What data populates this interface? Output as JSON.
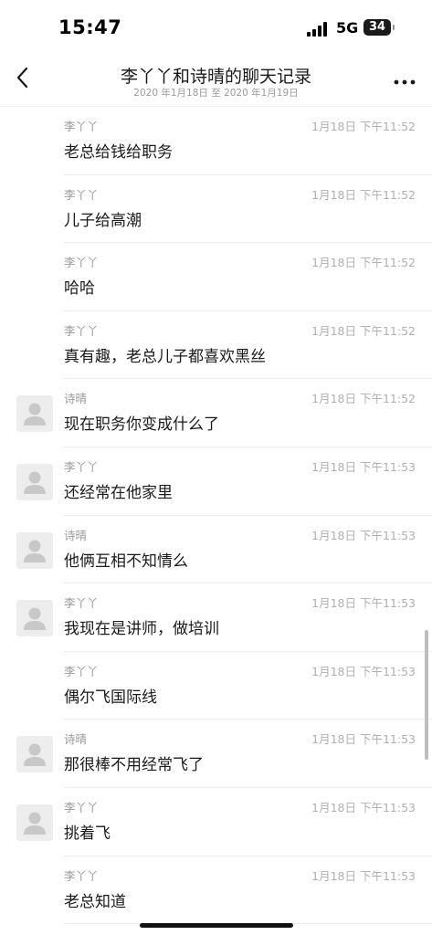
{
  "status_bar": {
    "time": "15:47",
    "network": "5G",
    "battery": "34"
  },
  "nav": {
    "back_icon": "chevron-left-icon",
    "title": "李丫丫和诗晴的聊天记录",
    "subtitle": "2020 年1月18日 至 2020 年1月19日",
    "more_icon": "ellipsis-icon"
  },
  "messages": [
    {
      "sender": "李丫丫",
      "time": "1月18日 下午11:52",
      "content": "老总给钱给职务",
      "avatar": false
    },
    {
      "sender": "李丫丫",
      "time": "1月18日 下午11:52",
      "content": "儿子给高潮",
      "avatar": false
    },
    {
      "sender": "李丫丫",
      "time": "1月18日 下午11:52",
      "content": "哈哈",
      "avatar": false
    },
    {
      "sender": "李丫丫",
      "time": "1月18日 下午11:52",
      "content": "真有趣，老总儿子都喜欢黑丝",
      "avatar": false
    },
    {
      "sender": "诗晴",
      "time": "1月18日 下午11:52",
      "content": "现在职务你变成什么了",
      "avatar": true
    },
    {
      "sender": "李丫丫",
      "time": "1月18日 下午11:53",
      "content": "还经常在他家里",
      "avatar": true
    },
    {
      "sender": "诗晴",
      "time": "1月18日 下午11:53",
      "content": "他俩互相不知情么",
      "avatar": true
    },
    {
      "sender": "李丫丫",
      "time": "1月18日 下午11:53",
      "content": "我现在是讲师，做培训",
      "avatar": true
    },
    {
      "sender": "李丫丫",
      "time": "1月18日 下午11:53",
      "content": "偶尔飞国际线",
      "avatar": false
    },
    {
      "sender": "诗晴",
      "time": "1月18日 下午11:53",
      "content": "那很棒不用经常飞了",
      "avatar": true
    },
    {
      "sender": "李丫丫",
      "time": "1月18日 下午11:53",
      "content": "挑着飞",
      "avatar": true
    },
    {
      "sender": "李丫丫",
      "time": "1月18日 下午11:53",
      "content": "老总知道",
      "avatar": false
    }
  ]
}
